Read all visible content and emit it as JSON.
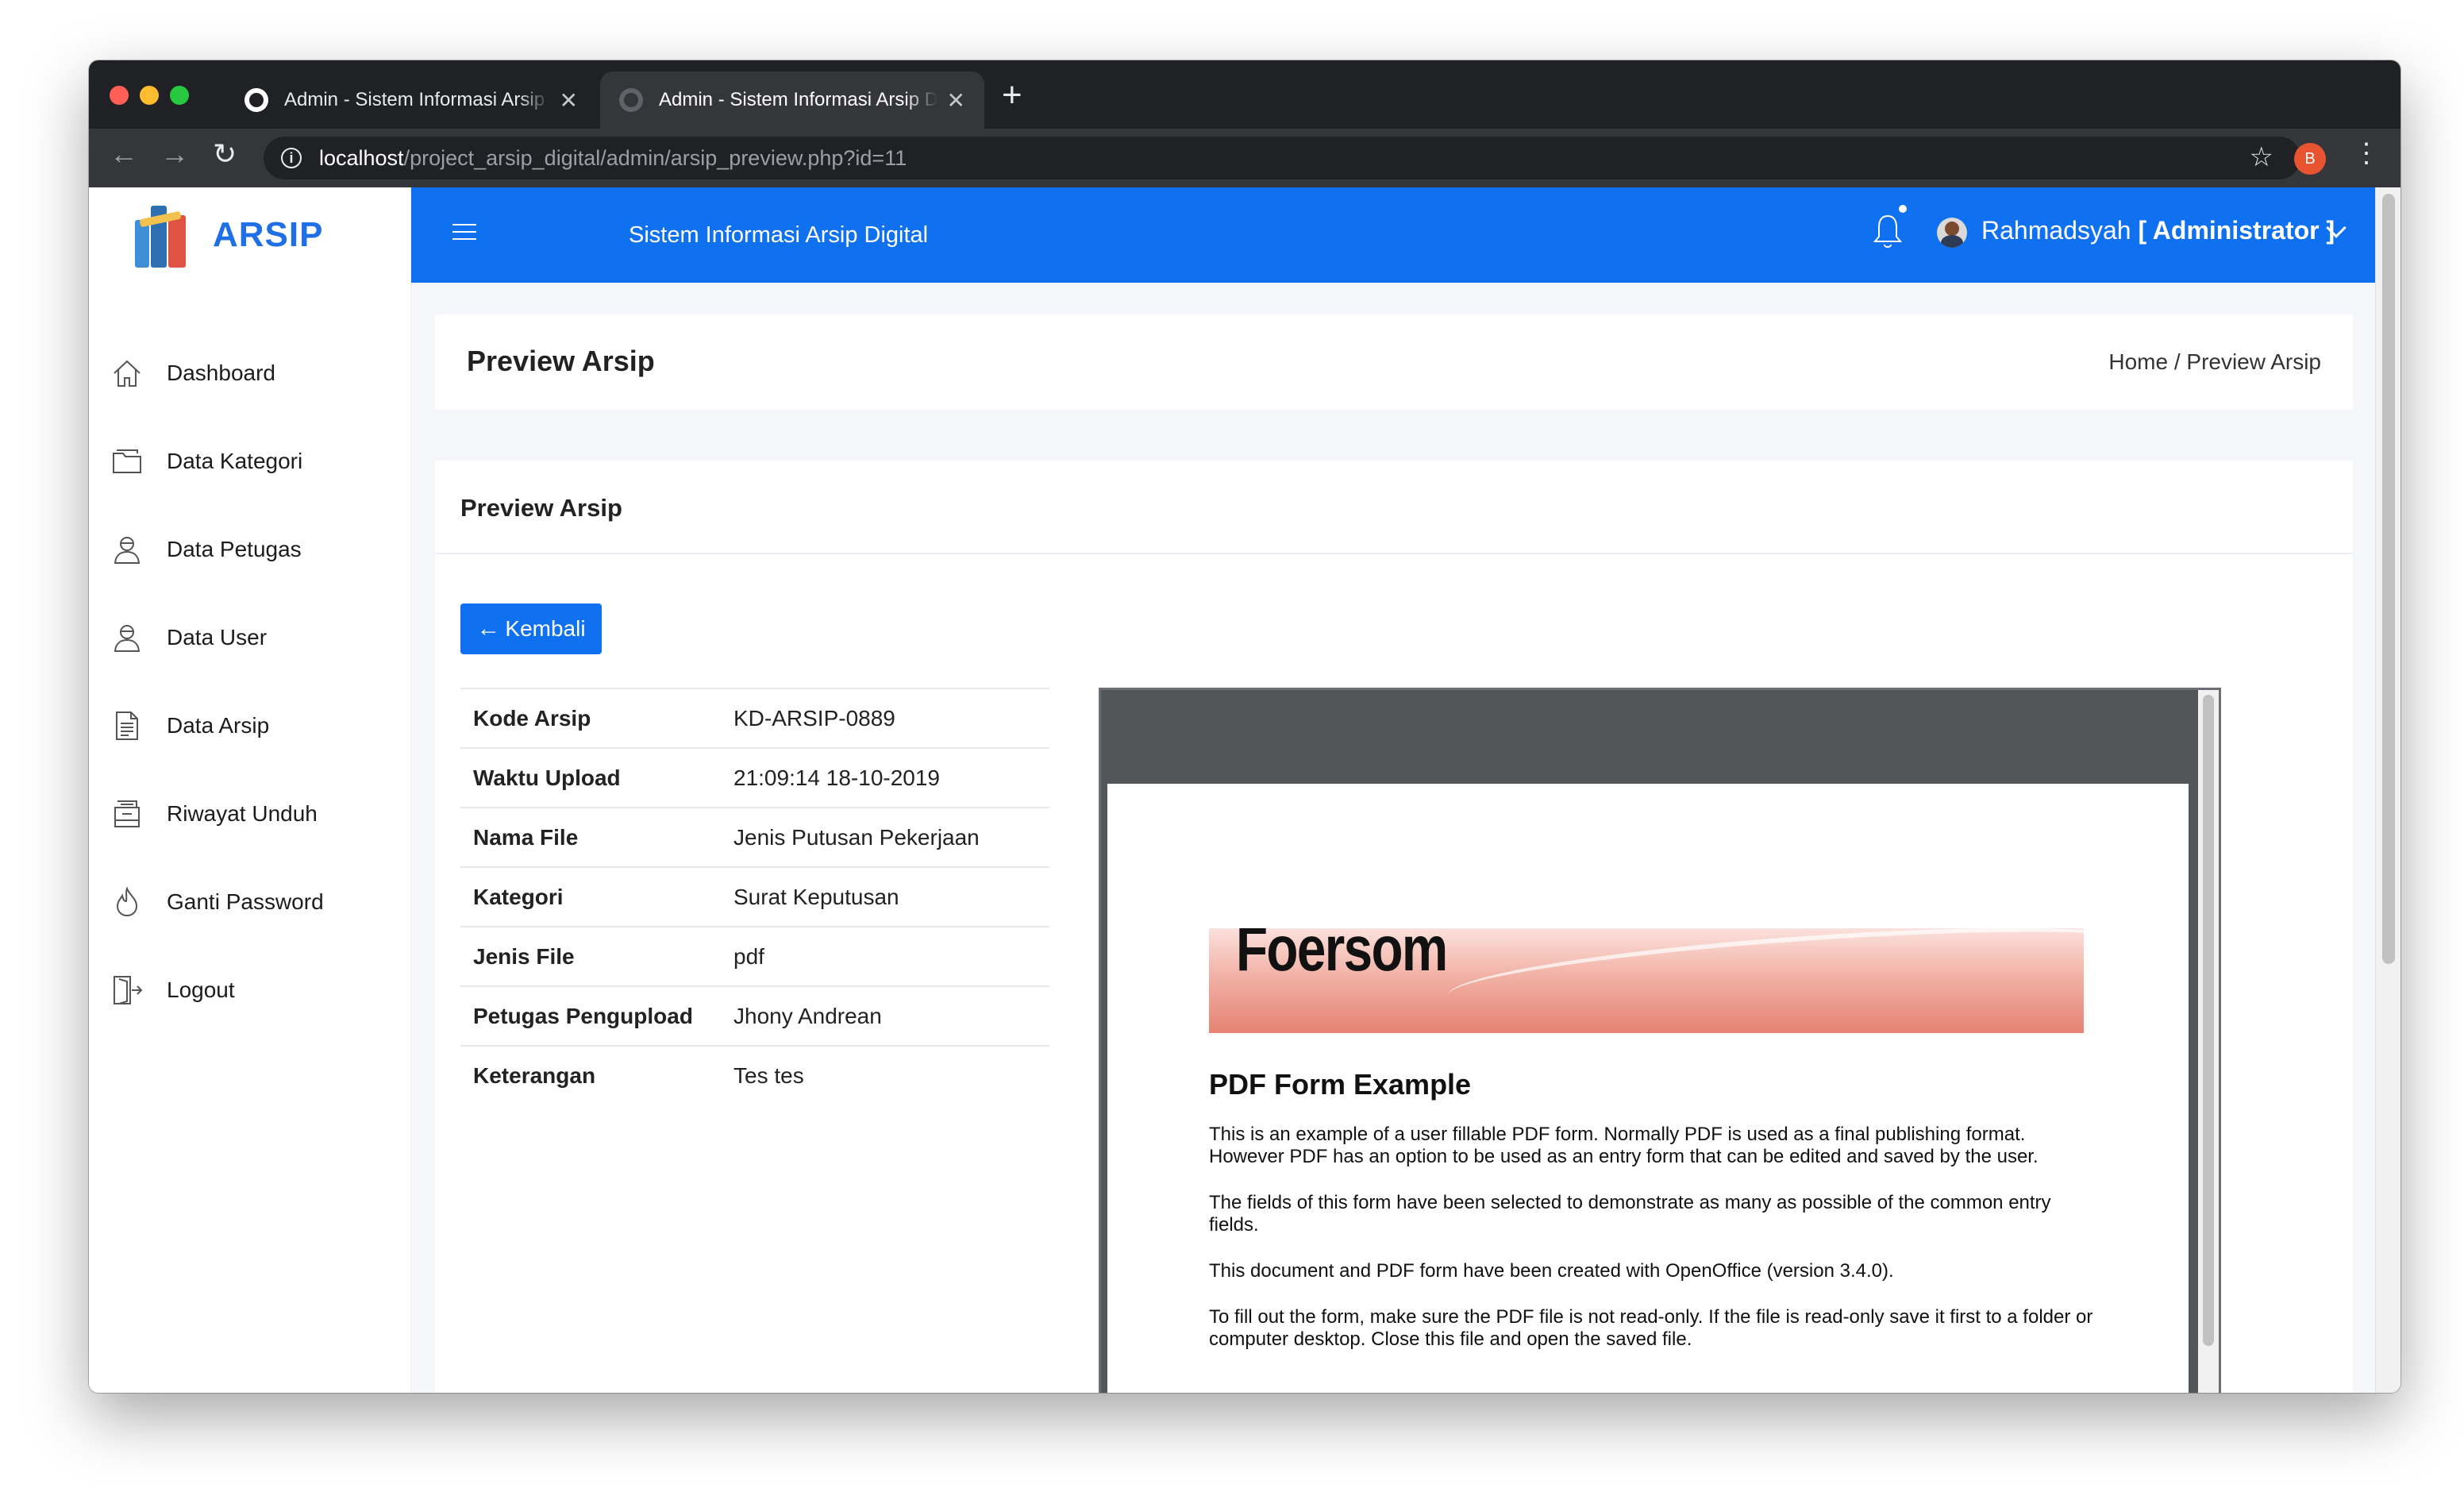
{
  "browser": {
    "tabs": [
      {
        "title": "Admin - Sistem Informasi Arsip Digital",
        "close": "✕"
      },
      {
        "title": "Admin - Sistem Informasi Arsip Digital",
        "close": "✕"
      }
    ],
    "new_tab": "+",
    "nav": {
      "back": "←",
      "forward": "→",
      "reload": "↻",
      "info": "i"
    },
    "url": {
      "host": "localhost",
      "path": "/project_arsip_digital/admin/arsip_preview.php?id=11"
    },
    "star": "☆",
    "profile_initial": "B",
    "menu": "⋮"
  },
  "sidebar": {
    "brand": "ARSIP",
    "items": [
      {
        "label": "Dashboard",
        "icon": "home-icon"
      },
      {
        "label": "Data Kategori",
        "icon": "folder-icon"
      },
      {
        "label": "Data Petugas",
        "icon": "user-icon"
      },
      {
        "label": "Data User",
        "icon": "user-icon"
      },
      {
        "label": "Data Arsip",
        "icon": "document-icon"
      },
      {
        "label": "Riwayat Unduh",
        "icon": "archive-box-icon"
      },
      {
        "label": "Ganti Password",
        "icon": "flame-icon"
      },
      {
        "label": "Logout",
        "icon": "logout-door-icon"
      }
    ]
  },
  "topbar": {
    "title": "Sistem Informasi Arsip Digital",
    "user_name": "Rahmadsyah",
    "user_role": "[ Administrator ]",
    "accent": "#0f70f0"
  },
  "header": {
    "title": "Preview Arsip",
    "breadcrumb": "Home / Preview Arsip"
  },
  "card": {
    "title": "Preview Arsip",
    "back_arrow": "🡐",
    "back_label": "Kembali",
    "details": [
      {
        "key": "Kode Arsip",
        "value": "KD-ARSIP-0889"
      },
      {
        "key": "Waktu Upload",
        "value": "21:09:14 18-10-2019"
      },
      {
        "key": "Nama File",
        "value": "Jenis Putusan Pekerjaan"
      },
      {
        "key": "Kategori",
        "value": "Surat Keputusan"
      },
      {
        "key": "Jenis File",
        "value": "pdf"
      },
      {
        "key": "Petugas Pengupload",
        "value": "Jhony Andrean"
      },
      {
        "key": "Keterangan",
        "value": "Tes tes"
      }
    ]
  },
  "pdf": {
    "logo": "Foersom",
    "heading": "PDF Form Example",
    "paragraphs": [
      "This is an example of a user fillable PDF form. Normally PDF is used as a final publishing format. However PDF has an option to be used as an entry form that can be edited and saved by the user.",
      "The fields of this form have been selected to demonstrate as many as possible of the common entry fields.",
      "This document and PDF form have been created with OpenOffice (version 3.4.0).",
      "To fill out the form, make sure the PDF file is not read-only. If the file is read-only save it first to a folder or computer desktop. Close this file and open the saved file."
    ]
  }
}
